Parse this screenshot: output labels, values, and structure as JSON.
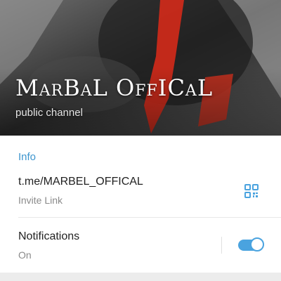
{
  "header": {
    "title": "MarBaL OffICaL",
    "subtitle": "public channel"
  },
  "info": {
    "heading": "Info",
    "link": {
      "value": "t.me/MARBEL_OFFICAL",
      "caption": "Invite Link",
      "action_icon": "qr-code-icon"
    },
    "notifications": {
      "label": "Notifications",
      "state": "On",
      "enabled": true
    }
  },
  "colors": {
    "accent": "#3d95ce",
    "toggle": "#4aa3df"
  }
}
